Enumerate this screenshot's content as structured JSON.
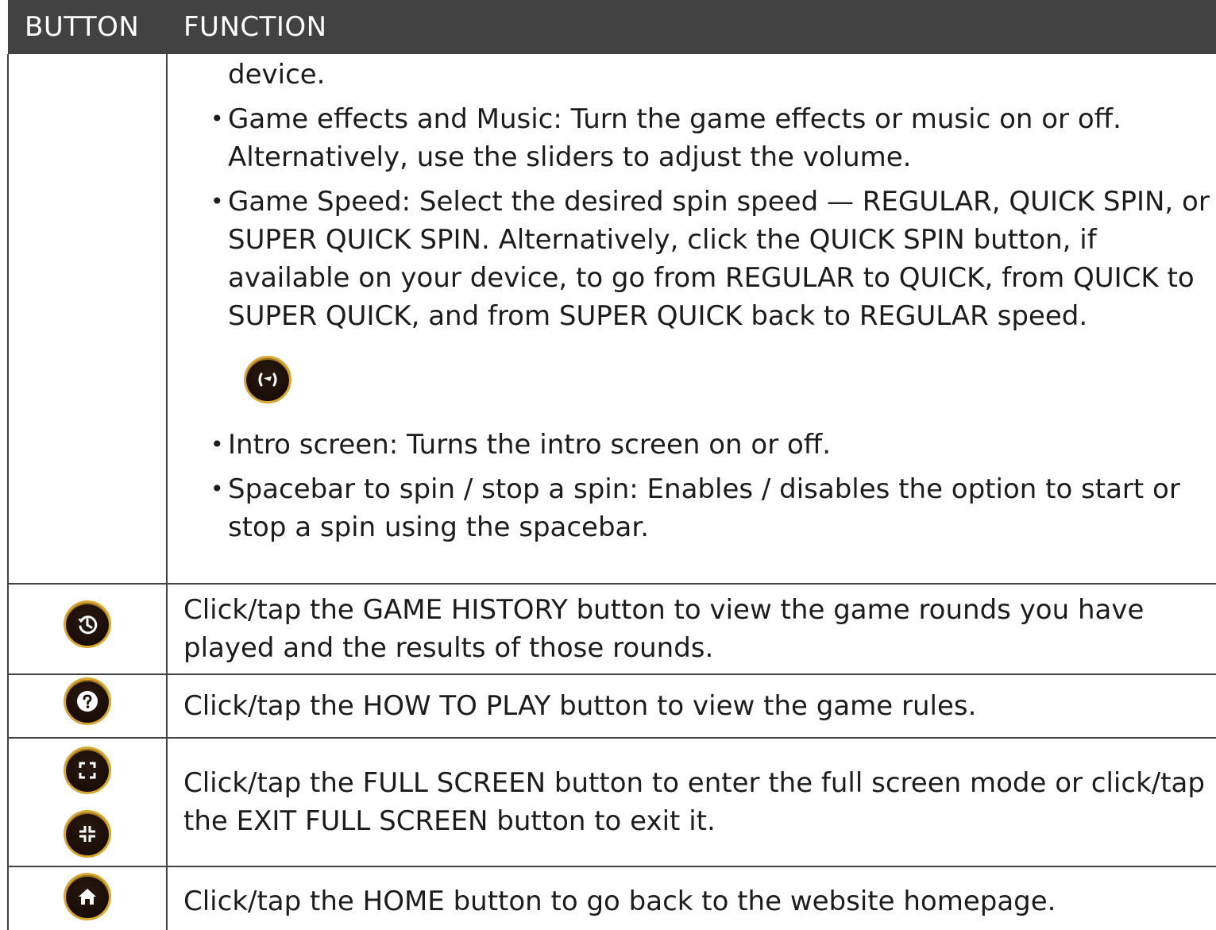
{
  "header": {
    "button_col": "BUTTON",
    "function_col": "FUNCTION"
  },
  "settings_row": {
    "continuation": "device.",
    "items": [
      {
        "text": "Game effects and Music: Turn the game effects or music on or off. Alternatively, use the sliders to adjust the volume."
      },
      {
        "text": "Game Speed: Select the desired spin speed — REGULAR, QUICK SPIN, or SUPER QUICK SPIN. Alternatively, click the QUICK SPIN button, if available on your device, to go from REGULAR to QUICK, from QUICK to SUPER QUICK, and from SUPER QUICK back to REGULAR speed."
      },
      {
        "text": "Intro screen: Turns the intro screen on or off."
      },
      {
        "text": "Spacebar to spin / stop a spin: Enables / disables the option to start or stop a spin using the spacebar."
      }
    ],
    "bullet": "•",
    "speed_icon": "quick-spin-icon"
  },
  "rows": {
    "history": {
      "icon": "history-icon",
      "text": "Click/tap the GAME HISTORY button to view the game rounds you have played and the results of those rounds."
    },
    "howto": {
      "icon": "question-icon",
      "text": "Click/tap the HOW TO PLAY button to view the game rules."
    },
    "fullscreen": {
      "icons": [
        "fullscreen-enter-icon",
        "fullscreen-exit-icon"
      ],
      "text": "Click/tap the FULL SCREEN button to enter the full screen mode or click/tap the EXIT FULL SCREEN button to exit it."
    },
    "home": {
      "icon": "home-icon",
      "text": "Click/tap the HOME button to go back to the website homepage."
    }
  },
  "colors": {
    "header_bg": "#424242",
    "button_bg": "#1a0d06",
    "button_ring": "#d8a733"
  }
}
